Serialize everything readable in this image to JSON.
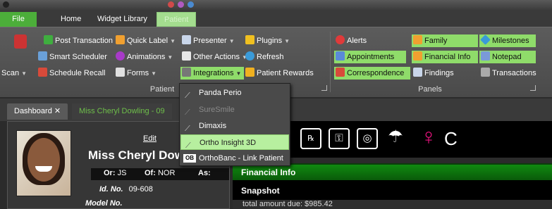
{
  "app_tabs": {
    "file": "File",
    "home": "Home",
    "widget_library": "Widget Library",
    "ribbon_active": "Patient"
  },
  "patient_group": {
    "label": "Patient",
    "scan": "Scan",
    "post_transaction": "Post Transaction",
    "quick_label": "Quick Label",
    "presenter": "Presenter",
    "plugins": "Plugins",
    "smart_scheduler": "Smart Scheduler",
    "animations": "Animations",
    "other_actions": "Other Actions",
    "refresh": "Refresh",
    "schedule_recall": "Schedule Recall",
    "forms": "Forms",
    "integrations": "Integrations",
    "patient_rewards": "Patient Rewards"
  },
  "panels_group": {
    "label": "Panels",
    "alerts": "Alerts",
    "family": "Family",
    "milestones": "Milestones",
    "appointments": "Appointments",
    "financial_info": "Financial Info",
    "notepad": "Notepad",
    "correspondence": "Correspondence",
    "findings": "Findings",
    "transactions": "Transactions"
  },
  "integrations_menu": {
    "items": [
      {
        "label": "Panda Perio",
        "enabled": true
      },
      {
        "label": "SureSmile",
        "enabled": false
      },
      {
        "label": "Dimaxis",
        "enabled": true
      },
      {
        "label": "Ortho Insight 3D",
        "enabled": true,
        "highlighted": true
      },
      {
        "label": "OrthoBanc - Link Patient",
        "enabled": true
      }
    ],
    "ob_badge": "OB"
  },
  "doc_tabs": {
    "dashboard": "Dashboard",
    "patient": "Miss Cheryl Dowling - 09"
  },
  "patient_card": {
    "edit": "Edit",
    "name": "Miss Cheryl Dow",
    "or_label": "Or:",
    "or_value": "JS",
    "of_label": "Of:",
    "of_value": "NOR",
    "as_label": "As:",
    "id_label": "Id. No.",
    "id_value": "09-608",
    "model_label": "Model No."
  },
  "icon_bar": {
    "cut_letter": "C"
  },
  "financial": {
    "title": "Financial Info",
    "snapshot": "Snapshot",
    "total_text": "total amount due:  $985.42"
  },
  "colors": {
    "accent_green": "#4cae3a",
    "panel_green": "#8fdc6a",
    "highlight_green": "#b7ef9f",
    "female_pink": "#e6127c"
  }
}
